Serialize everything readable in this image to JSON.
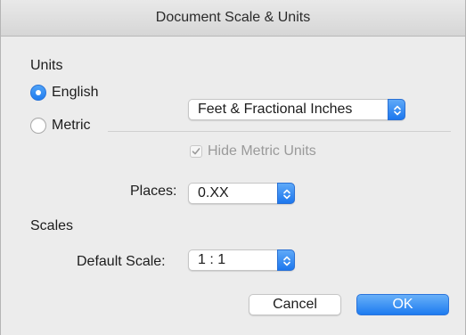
{
  "window": {
    "title": "Document Scale & Units"
  },
  "units": {
    "section_label": "Units",
    "english_label": "English",
    "metric_label": "Metric",
    "selected": "English",
    "format_value": "Feet & Fractional Inches",
    "hide_metric_label": "Hide Metric Units",
    "hide_metric_checked": true,
    "hide_metric_enabled": false
  },
  "places": {
    "label": "Places:",
    "value": "0.XX"
  },
  "scales": {
    "section_label": "Scales",
    "default_scale_label": "Default Scale:",
    "default_scale_value": "1 : 1"
  },
  "buttons": {
    "cancel": "Cancel",
    "ok": "OK"
  },
  "colors": {
    "accent": "#1f7cf0",
    "background": "#ececec"
  },
  "icons": {
    "stepper": "chevron-up-down-icon",
    "check": "checkmark-icon"
  }
}
